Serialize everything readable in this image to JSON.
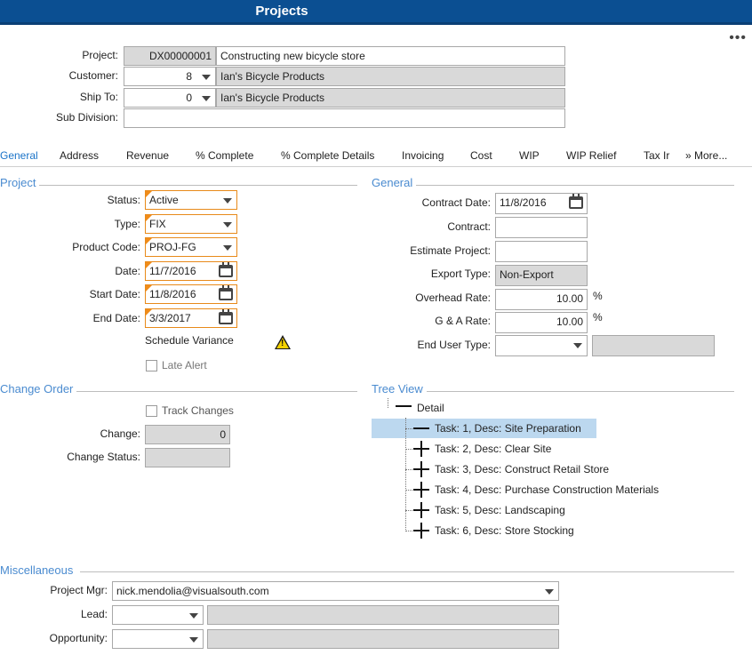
{
  "window": {
    "title": "Projects"
  },
  "header": {
    "project_label": "Project:",
    "project_id": "DX00000001",
    "project_desc": "Constructing new bicycle store",
    "customer_label": "Customer:",
    "customer_value": "8",
    "customer_name": "Ian's Bicycle Products",
    "shipto_label": "Ship To:",
    "shipto_value": "0",
    "shipto_name": "Ian's Bicycle Products",
    "subdivision_label": "Sub Division:",
    "subdivision_value": ""
  },
  "tabs": [
    "General",
    "Address",
    "Revenue",
    "% Complete",
    "% Complete Details",
    "Invoicing",
    "Cost",
    "WIP",
    "WIP Relief",
    "Tax Ir"
  ],
  "tabs_more": "More...",
  "project_section": {
    "heading": "Project",
    "status_label": "Status:",
    "status_value": "Active",
    "type_label": "Type:",
    "type_value": "FIX",
    "product_label": "Product Code:",
    "product_value": "PROJ-FG",
    "date_label": "Date:",
    "date_value": "11/7/2016",
    "start_label": "Start Date:",
    "start_value": "11/8/2016",
    "end_label": "End Date:",
    "end_value": "3/3/2017",
    "schedule_variance": "Schedule Variance",
    "late_alert": "Late Alert"
  },
  "general_section": {
    "heading": "General",
    "contract_date_label": "Contract Date:",
    "contract_date_value": "11/8/2016",
    "contract_label": "Contract:",
    "contract_value": "",
    "estimate_label": "Estimate Project:",
    "estimate_value": "",
    "export_label": "Export Type:",
    "export_value": "Non-Export",
    "overhead_label": "Overhead Rate:",
    "overhead_value": "10.00",
    "ga_label": "G & A Rate:",
    "ga_value": "10.00",
    "percent_sign": "%",
    "end_user_label": "End User Type:",
    "end_user_value": ""
  },
  "change_order": {
    "heading": "Change Order",
    "track_changes": "Track Changes",
    "change_label": "Change:",
    "change_value": "0",
    "status_label": "Change Status:",
    "status_value": ""
  },
  "tree_view": {
    "heading": "Tree View",
    "root": "Detail",
    "items": [
      "Task: 1, Desc: Site Preparation",
      "Task: 2, Desc: Clear Site",
      "Task: 3, Desc: Construct Retail Store",
      "Task: 4, Desc: Purchase Construction Materials",
      "Task: 5, Desc: Landscaping",
      "Task: 6, Desc: Store Stocking"
    ]
  },
  "misc": {
    "heading": "Miscellaneous",
    "pm_label": "Project Mgr:",
    "pm_value": "nick.mendolia@visualsouth.com",
    "lead_label": "Lead:",
    "lead_value": "",
    "opp_label": "Opportunity:",
    "opp_value": ""
  }
}
